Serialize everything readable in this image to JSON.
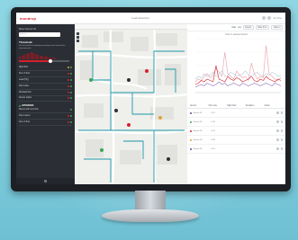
{
  "app": {
    "brand": "mondrup",
    "title": "Leak Detection",
    "user": "Jon Doe"
  },
  "sidebar": {
    "search_label": "Meter Sensor ID",
    "search_placeholder": "Search",
    "threshold_heading": "Threshold",
    "threshold_note": "Set threshold for displaying leakage and monitor flow measurement",
    "threshold_level": 0.62,
    "histogram": [
      0.3,
      0.45,
      0.55,
      0.7,
      0.8,
      0.95,
      0.85,
      0.7,
      0.6,
      0.5,
      0.45,
      0.35,
      0.3,
      0.25,
      0.2,
      0.15,
      0.1
    ],
    "rows": [
      {
        "label": "Night flow",
        "dot_colors": [
          "#e0a33a",
          "#3aa655"
        ]
      },
      {
        "label": "Sum of flow",
        "dot_colors": [
          "#d61f2c",
          "#3aa655"
        ]
      },
      {
        "label": "Leak (HQ)",
        "dot_colors": [
          "#d61f2c",
          "#3aa655"
        ]
      },
      {
        "label": "Flow value",
        "dot_colors": [
          "#d61f2c",
          "#3aa655"
        ]
      },
      {
        "label": "Residual flow",
        "dot_colors": [
          "#d61f2c",
          "#3aa655"
        ]
      },
      {
        "label": "Sensor status",
        "dot_colors": [
          "#d61f2c",
          "#3aa655"
        ]
      }
    ],
    "section_label": "ADVANCED",
    "section_rows": [
      {
        "label": "Meters with zero flow",
        "dot_colors": [
          "#3aa655"
        ]
      },
      {
        "label": "Flow meters",
        "dot_colors": [
          "#d61f2c",
          "#3aa655"
        ]
      },
      {
        "label": "Sum of flow",
        "dot_colors": [
          "#d61f2c",
          "#3aa655"
        ]
      }
    ]
  },
  "right": {
    "header_items": [
      "Map",
      "List",
      "Export",
      "Date from",
      "Date to"
    ],
    "chart_title": "Flow in selected period",
    "table_headers": [
      "Sensor",
      "Flow rate",
      "Night flow",
      "Deviation",
      "Action"
    ],
    "table_rows": [
      {
        "name": "Sensor 01",
        "value": "0.12",
        "color": "#6a3fa0"
      },
      {
        "name": "Sensor 02",
        "value": "0.18",
        "color": "#3aa655"
      },
      {
        "name": "Sensor 03",
        "value": "0.24",
        "color": "#d61f2c"
      },
      {
        "name": "Sensor 04",
        "value": "0.09",
        "color": "#e0a33a"
      },
      {
        "name": "Sensor 05",
        "value": "0.15",
        "color": "#6a3fa0"
      }
    ]
  },
  "colors": {
    "accent": "#d61f2c",
    "sidebar_bg": "#2b2f35",
    "pipe": "#1a9aa8"
  },
  "chart_data": {
    "type": "line",
    "x": [
      1,
      2,
      3,
      4,
      5,
      6,
      7,
      8,
      9,
      10,
      11,
      12,
      13,
      14,
      15,
      16,
      17,
      18,
      19,
      20,
      21,
      22,
      23,
      24,
      25,
      26,
      27,
      28,
      29,
      30
    ],
    "series": [
      {
        "values": [
          8,
          10,
          9,
          12,
          14,
          11,
          13,
          18,
          15,
          12,
          30,
          14,
          12,
          10,
          16,
          13,
          11,
          12,
          9,
          22,
          14,
          10,
          12,
          11,
          35,
          14,
          12,
          10,
          9,
          11
        ]
      },
      {
        "values": [
          6,
          7,
          9,
          8,
          10,
          9,
          8,
          20,
          10,
          9,
          8,
          12,
          10,
          9,
          11,
          10,
          8,
          9,
          10,
          12,
          9,
          8,
          10,
          9,
          12,
          10,
          9,
          8,
          10,
          9
        ]
      },
      {
        "values": [
          4,
          5,
          6,
          5,
          7,
          6,
          5,
          6,
          8,
          6,
          7,
          5,
          6,
          7,
          6,
          5,
          7,
          6,
          5,
          6,
          7,
          6,
          5,
          6,
          7,
          6,
          5,
          7,
          6,
          5
        ]
      },
      {
        "values": [
          10,
          12,
          11,
          14,
          12,
          13,
          15,
          12,
          14,
          16,
          12,
          13,
          15,
          14,
          12,
          13,
          14,
          16,
          13,
          12,
          14,
          15,
          13,
          12,
          14,
          13,
          15,
          14,
          12,
          13
        ]
      }
    ],
    "series_colors": [
      "#e8a0a8",
      "#d61f2c",
      "#8c6cb3",
      "#b8c6d4"
    ],
    "ylim": [
      0,
      40
    ],
    "grid": true
  }
}
